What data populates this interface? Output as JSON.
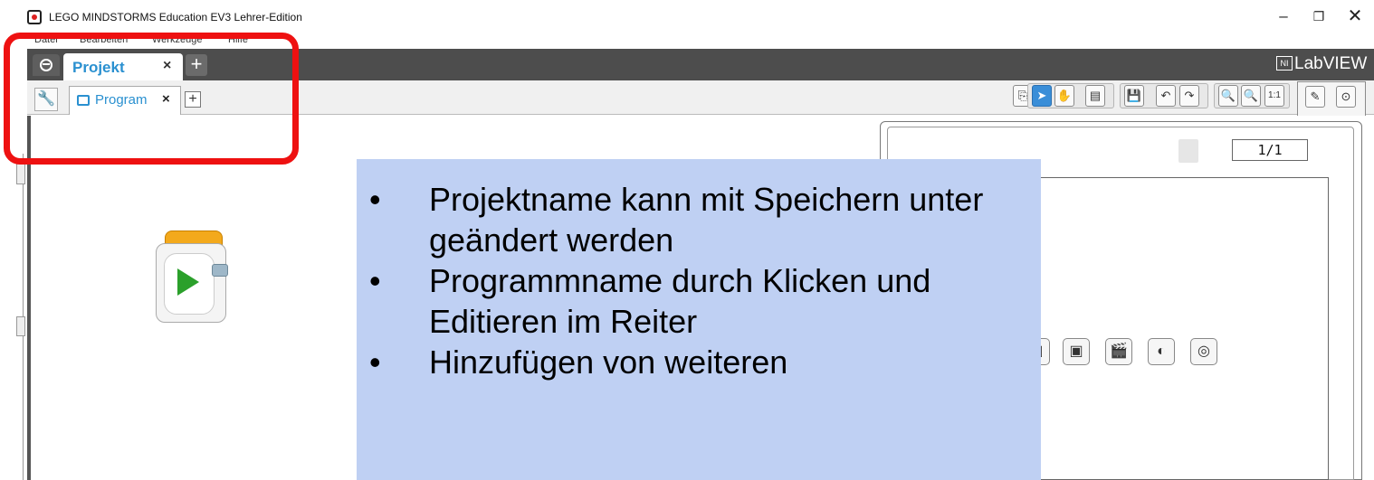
{
  "window": {
    "title": "LEGO MINDSTORMS Education EV3 Lehrer-Edition",
    "minimize": "–",
    "maximize": "❐",
    "close": "✕"
  },
  "menu": {
    "items": [
      "Datei",
      "Bearbeiten",
      "Werkzeuge",
      "Hilfe"
    ]
  },
  "project_tabs": {
    "active_label": "Projekt",
    "close": "×",
    "add": "+"
  },
  "brand": {
    "logo_text": "LabVIEW"
  },
  "program_tabs": {
    "active_label": "Program",
    "close": "×",
    "add": "+"
  },
  "hardware_page": {
    "page_indicator": "1/1"
  },
  "callout": {
    "bullets": [
      "Projektname kann mit Speichern unter geändert werden",
      "Programmname durch Klicken und Editieren im Reiter",
      "Hinzufügen von weiteren"
    ]
  },
  "colors": {
    "accent": "#2a90d0",
    "highlight": "#ee1111",
    "callout_bg": "#bfd0f3",
    "start_block": "#f3a91c"
  }
}
